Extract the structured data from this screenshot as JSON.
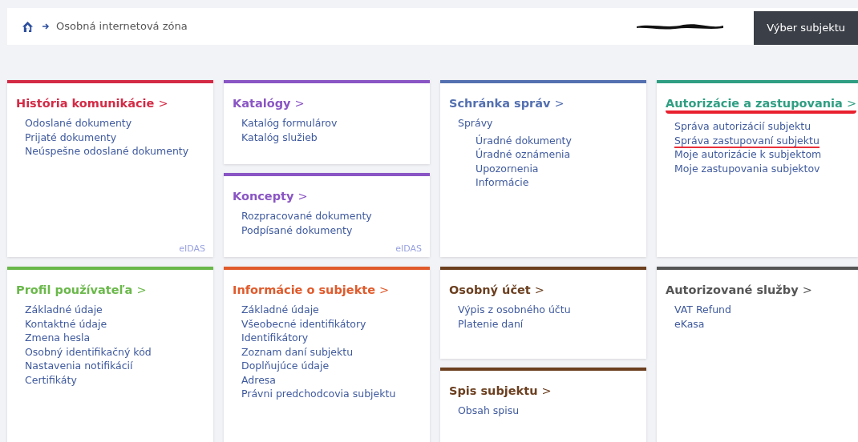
{
  "header": {
    "breadcrumb": "Osobná internetová zóna",
    "button": "Výber subjektu"
  },
  "rows": [
    [
      [
        {
          "title": "História komunikácie",
          "arrow": ">",
          "color": "#d42a45",
          "highlighted": false,
          "badge": "eIDAS",
          "items": [
            {
              "label": "Odoslané dokumenty",
              "highlighted": false
            },
            {
              "label": "Prijaté dokumenty",
              "highlighted": false
            },
            {
              "label": "Neúspešne odoslané dokumenty",
              "highlighted": false
            }
          ]
        }
      ],
      [
        {
          "title": "Katalógy",
          "arrow": ">",
          "color": "#8a55c4",
          "highlighted": false,
          "items": [
            {
              "label": "Katalóg formulárov",
              "highlighted": false
            },
            {
              "label": "Katalóg služieb",
              "highlighted": false
            }
          ]
        },
        {
          "title": "Koncepty",
          "arrow": ">",
          "color": "#8a55c4",
          "highlighted": false,
          "badge": "eIDAS",
          "items": [
            {
              "label": "Rozpracované dokumenty",
              "highlighted": false
            },
            {
              "label": "Podpísané dokumenty",
              "highlighted": false
            }
          ]
        }
      ],
      [
        {
          "title": "Schránka správ",
          "arrow": ">",
          "color": "#5470b0",
          "highlighted": false,
          "items": [
            {
              "label": "Správy",
              "highlighted": false,
              "children": [
                {
                  "label": "Úradné dokumenty",
                  "highlighted": false
                },
                {
                  "label": "Úradné oznámenia",
                  "highlighted": false
                },
                {
                  "label": "Upozornenia",
                  "highlighted": false
                },
                {
                  "label": "Informácie",
                  "highlighted": false
                }
              ]
            }
          ]
        }
      ],
      [
        {
          "title": "Autorizácie a zastupovania",
          "arrow": ">",
          "color": "#2f9e82",
          "highlighted": true,
          "items": [
            {
              "label": "Správa autorizácií subjektu",
              "highlighted": false
            },
            {
              "label": "Správa zastupovaní subjektu",
              "highlighted": true
            },
            {
              "label": "Moje autorizácie k subjektom",
              "highlighted": false
            },
            {
              "label": "Moje zastupovania subjektov",
              "highlighted": false
            }
          ]
        }
      ]
    ],
    [
      [
        {
          "title": "Profil používateľa",
          "arrow": ">",
          "color": "#6ab84a",
          "highlighted": false,
          "items": [
            {
              "label": "Základné údaje",
              "highlighted": false
            },
            {
              "label": "Kontaktné údaje",
              "highlighted": false
            },
            {
              "label": "Zmena hesla",
              "highlighted": false
            },
            {
              "label": "Osobný identifikačný kód",
              "highlighted": false
            },
            {
              "label": "Nastavenia notifikácií",
              "highlighted": false
            },
            {
              "label": "Certifikáty",
              "highlighted": false
            }
          ]
        }
      ],
      [
        {
          "title": "Informácie o subjekte",
          "arrow": ">",
          "color": "#e05a2b",
          "highlighted": false,
          "items": [
            {
              "label": "Základné údaje",
              "highlighted": false
            },
            {
              "label": "Všeobecné identifikátory",
              "highlighted": false
            },
            {
              "label": "Identifikátory",
              "highlighted": false
            },
            {
              "label": "Zoznam daní subjektu",
              "highlighted": false
            },
            {
              "label": "Doplňujúce údaje",
              "highlighted": false
            },
            {
              "label": "Adresa",
              "highlighted": false
            },
            {
              "label": "Právni predchodcovia subjektu",
              "highlighted": false
            }
          ]
        }
      ],
      [
        {
          "title": "Osobný účet",
          "arrow": ">",
          "color": "#6b3f1f",
          "highlighted": false,
          "items": [
            {
              "label": "Výpis z osobného účtu",
              "highlighted": false
            },
            {
              "label": "Platenie daní",
              "highlighted": false
            }
          ]
        },
        {
          "title": "Spis subjektu",
          "arrow": ">",
          "color": "#6b3f1f",
          "highlighted": false,
          "items": [
            {
              "label": "Obsah spisu",
              "highlighted": false
            }
          ]
        }
      ],
      [
        {
          "title": "Autorizované služby",
          "arrow": ">",
          "color": "#555555",
          "highlighted": false,
          "items": [
            {
              "label": "VAT Refund",
              "highlighted": false
            },
            {
              "label": "eKasa",
              "highlighted": false
            }
          ]
        }
      ]
    ]
  ]
}
